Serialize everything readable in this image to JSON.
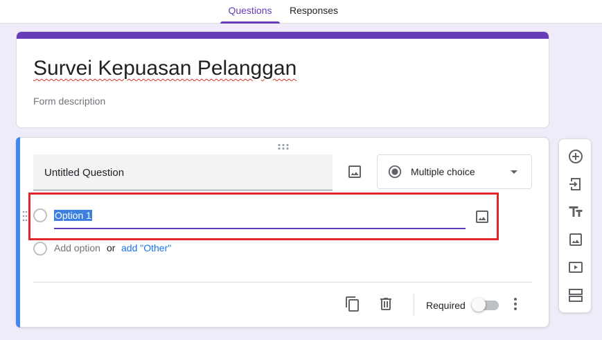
{
  "tabs": [
    {
      "label": "Questions",
      "active": true
    },
    {
      "label": "Responses",
      "active": false
    }
  ],
  "form": {
    "title": "Survei Kepuasan Pelanggan",
    "description_placeholder": "Form description"
  },
  "question": {
    "title": "Untitled Question",
    "type": "Multiple choice",
    "options": [
      "Option 1"
    ],
    "add_option": "Add option",
    "or": "or",
    "add_other": "add \"Other\"",
    "required_label": "Required",
    "required": false
  },
  "toolbar_icons": [
    "add-question-icon",
    "import-questions-icon",
    "add-title-icon",
    "add-image-icon",
    "add-video-icon",
    "add-section-icon"
  ],
  "colors": {
    "accent": "#673ab7",
    "active_card": "#4285f4",
    "background": "#f0ebf8",
    "highlight": "#e0252b",
    "selection": "#3b7fe0"
  }
}
